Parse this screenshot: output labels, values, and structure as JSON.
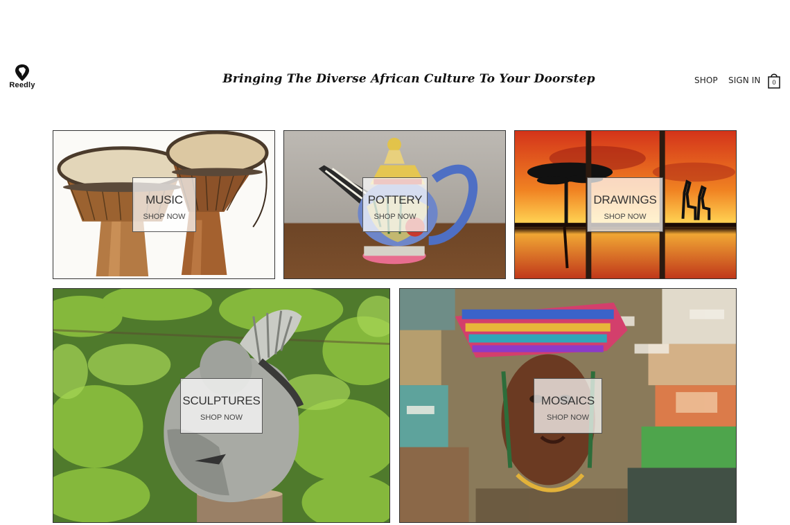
{
  "header": {
    "logo_text": "Reedly",
    "tagline": "Bringing The Diverse African Culture To Your Doorstep",
    "nav": {
      "shop": "SHOP",
      "sign_in": "SIGN IN"
    },
    "cart_count": "0"
  },
  "categories": [
    {
      "title": "MUSIC",
      "cta": "SHOP NOW"
    },
    {
      "title": "POTTERY",
      "cta": "SHOP NOW"
    },
    {
      "title": "DRAWINGS",
      "cta": "SHOP NOW"
    },
    {
      "title": "SCULPTURES",
      "cta": "SHOP NOW"
    },
    {
      "title": "MOSAICS",
      "cta": "SHOP NOW"
    }
  ],
  "colors": {
    "background": "#ffffff",
    "text": "#222222",
    "overlay": "#ffffffb8"
  },
  "icons": {
    "logo": "africa-pin-icon",
    "cart": "shopping-bag-icon"
  }
}
